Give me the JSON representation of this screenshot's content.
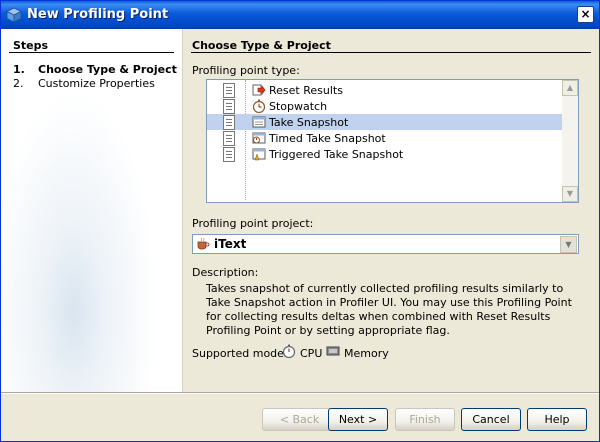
{
  "window": {
    "title": "New Profiling Point",
    "close_glyph": "×"
  },
  "steps": {
    "heading": "Steps",
    "items": [
      {
        "num": "1.",
        "label": "Choose Type & Project"
      },
      {
        "num": "2.",
        "label": "Customize Properties"
      }
    ]
  },
  "main": {
    "heading": "Choose Type & Project",
    "type_label": "Profiling point type:",
    "types": [
      {
        "label": "Reset Results",
        "icon": "reset-results-icon"
      },
      {
        "label": "Stopwatch",
        "icon": "stopwatch-icon"
      },
      {
        "label": "Take Snapshot",
        "icon": "take-snapshot-icon",
        "selected": true
      },
      {
        "label": "Timed Take Snapshot",
        "icon": "timed-snapshot-icon"
      },
      {
        "label": "Triggered Take Snapshot",
        "icon": "triggered-snapshot-icon"
      }
    ],
    "project_label": "Profiling point project:",
    "project_value": "iText",
    "description_label": "Description:",
    "description": "Takes snapshot of currently collected profiling results similarly to Take Snapshot action in Profiler UI. You may use this Profiling Point for collecting results deltas when combined with Reset Results Profiling Point or by setting appropriate flag.",
    "modes_label": "Supported modes:",
    "modes": [
      "CPU",
      "Memory"
    ]
  },
  "buttons": {
    "back": "< Back",
    "next": "Next >",
    "finish": "Finish",
    "cancel": "Cancel",
    "help": "Help"
  },
  "colors": {
    "titlebar": "#0a5ad9",
    "selection": "#c1d2ee",
    "dialog_bg": "#ece9d8"
  }
}
